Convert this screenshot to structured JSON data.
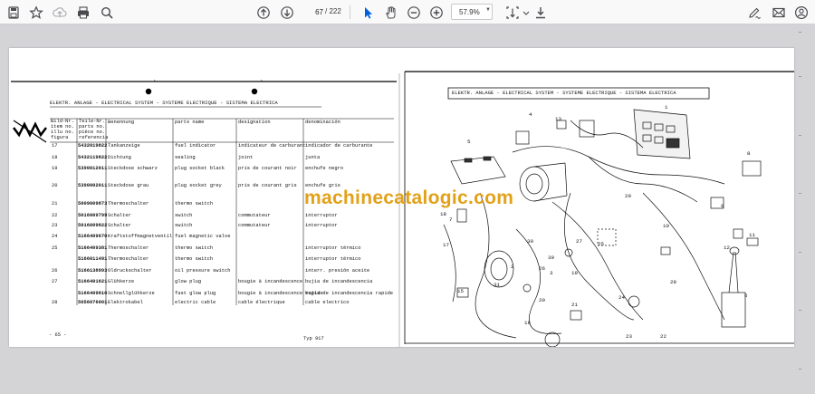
{
  "toolbar": {
    "page_current": "67",
    "page_total": "/ 222",
    "zoom": "57.9%",
    "icons": [
      "save-icon",
      "bookmark-star-icon",
      "upload-icon",
      "print-icon",
      "zoom-search-icon",
      "page-up-icon",
      "page-down-icon",
      "pointer-select-icon",
      "hand-pan-icon",
      "zoom-out-icon",
      "zoom-in-icon",
      "fit-page-icon",
      "download-icon",
      "edit-sign-icon",
      "mail-icon",
      "account-icon"
    ]
  },
  "left_page": {
    "title": "ELEKTR. ANLAGE   -   ELECTRICAL SYSTEM   -   SYSTEME ELECTRIQUE   -   SISTEMA ELECTRICA",
    "columns": [
      "Bild-Nr. item no. illu no. figura",
      "Teile-Nr. parts no. pièce no. referencia",
      "Benennung",
      "parts name",
      "designation",
      "denominación"
    ],
    "col_header_lines": {
      "fig": [
        "Bild-Nr.",
        "item no.",
        "illu no.",
        "figura"
      ],
      "part": [
        "Teile-Nr.",
        "parts no.",
        "pièce no.",
        "referencia"
      ],
      "de": [
        "Benennung"
      ],
      "en": [
        "parts name"
      ],
      "fr": [
        "designation"
      ],
      "es": [
        "denominación"
      ]
    },
    "rows": [
      {
        "fig": "17",
        "part": "5432019822",
        "de": "Tankanzeige",
        "en": "fuel indicator",
        "fr": "indicateur de carburant",
        "es": "indicador de carburante"
      },
      {
        "fig": "18",
        "part": "5432119822",
        "de": "Dichtung",
        "en": "sealing",
        "fr": "joint",
        "es": "junta"
      },
      {
        "fig": "19",
        "part": "5390012011",
        "de": "Steckdose schwarz",
        "en": "plug socket black",
        "fr": "pris de courant noir",
        "es": "enchufe negro"
      },
      {
        "fig": "20",
        "part": "5390002011",
        "de": "Steckdose grau",
        "en": "plug socket grey",
        "fr": "pris de courant gris",
        "es": "enchufe gris"
      },
      {
        "fig": "21",
        "part": "5009009873",
        "de": "Thermoschalter",
        "en": "thermo switch",
        "fr": "",
        "es": ""
      },
      {
        "fig": "22",
        "part": "5016009799",
        "de": "Schalter",
        "en": "switch",
        "fr": "commutateur",
        "es": "interruptor"
      },
      {
        "fig": "23",
        "part": "5016009822",
        "de": "Schalter",
        "en": "switch",
        "fr": "commutateur",
        "es": "interruptor"
      },
      {
        "fig": "24",
        "part": "5166409670",
        "de": "Kraftstoffmagnetventil",
        "en": "fuel magnetic valve",
        "fr": "",
        "es": ""
      },
      {
        "fig": "25",
        "part": "5166409381",
        "de": "Thermoschalter",
        "en": "thermo switch",
        "fr": "",
        "es": "interruptor térmico"
      },
      {
        "fig": "",
        "part": "5166011491",
        "de": "Thermoschalter",
        "en": "thermo switch",
        "fr": "",
        "es": "interruptor térmico"
      },
      {
        "fig": "26",
        "part": "5166138993",
        "de": "Oldruckschalter",
        "en": "oil pressure switch",
        "fr": "",
        "es": "interr. presión aceite"
      },
      {
        "fig": "27",
        "part": "5166401621",
        "de": "Glühkerze",
        "en": "glow plug",
        "fr": "bougie à incandescence",
        "es": "bujia de incandescencia"
      },
      {
        "fig": "",
        "part": "5166409810",
        "de": "Schnellglühkerze",
        "en": "fast glow plug",
        "fr": "bougie à incandescence rapide",
        "es": "bujia de incandescencia rapide"
      },
      {
        "fig": "28",
        "part": "5056076001",
        "de": "Elektrokabel",
        "en": "electric cable",
        "fr": "cable électrique",
        "es": "cable electrico"
      }
    ],
    "page_number": "- 65 -",
    "type_label": "Typ 917"
  },
  "right_page": {
    "title": "ELEKTR. ANLAGE   -   ELECTRICAL SYSTEM   -   SYSTEME ELECTRIQUE   -   SISTEMA ELECTRICA",
    "callouts": [
      "1",
      "4",
      "5",
      "6",
      "7",
      "8",
      "9",
      "10",
      "11",
      "12",
      "13",
      "15",
      "16",
      "17",
      "18",
      "19",
      "20",
      "21",
      "22",
      "23",
      "24",
      "25",
      "26",
      "27",
      "28",
      "29",
      "30",
      "31",
      "39",
      "2",
      "3"
    ]
  },
  "watermark": "machinecatalogic.com",
  "colors": {
    "toolbar_bg": "#f9f9fa",
    "viewer_bg": "#d4d4d7",
    "accent": "#0060df",
    "watermark": "#e2a118"
  }
}
